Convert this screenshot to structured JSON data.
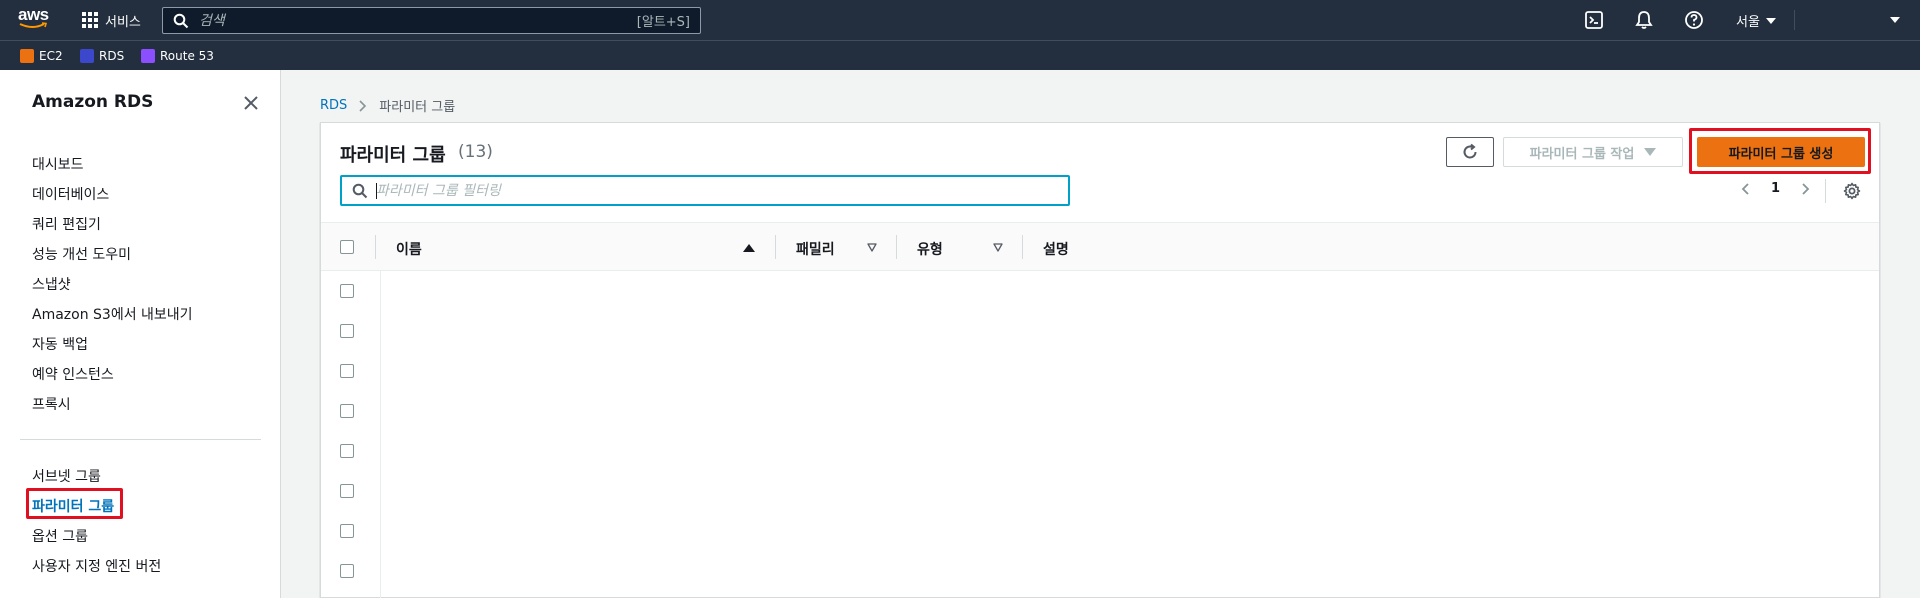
{
  "topnav": {
    "logo_text": "aws",
    "services_label": "서비스",
    "search_placeholder": "검색",
    "search_shortcut": "[알트+S]",
    "region_label": "서울"
  },
  "favorites": [
    {
      "label": "EC2",
      "color": "#ec7211"
    },
    {
      "label": "RDS",
      "color": "#3b48cc"
    },
    {
      "label": "Route 53",
      "color": "#8c4fff"
    }
  ],
  "sidebar": {
    "title": "Amazon RDS",
    "items": [
      {
        "label": "대시보드"
      },
      {
        "label": "데이터베이스"
      },
      {
        "label": "쿼리 편집기"
      },
      {
        "label": "성능 개선 도우미"
      },
      {
        "label": "스냅샷"
      },
      {
        "label": "Amazon S3에서 내보내기"
      },
      {
        "label": "자동 백업"
      },
      {
        "label": "예약 인스턴스"
      },
      {
        "label": "프록시"
      }
    ],
    "items2": [
      {
        "label": "서브넷 그룹"
      },
      {
        "label": "파라미터 그룹"
      },
      {
        "label": "옵션 그룹"
      },
      {
        "label": "사용자 지정 엔진 버전"
      }
    ]
  },
  "breadcrumb": {
    "root": "RDS",
    "current": "파라미터 그룹"
  },
  "panel": {
    "title": "파라미터 그룹",
    "count": "(13)",
    "actions_label": "파라미터 그룹 작업",
    "create_label": "파라미터 그룹 생성",
    "filter_placeholder": "파라미터 그룹 필터링",
    "page_number": "1"
  },
  "table": {
    "columns": [
      {
        "label": "이름"
      },
      {
        "label": "패밀리"
      },
      {
        "label": "유형"
      },
      {
        "label": "설명"
      }
    ]
  },
  "colors": {
    "nav_bg": "#232f3e",
    "accent_orange": "#ec7211",
    "link_blue": "#0073bb",
    "highlight_red": "#e01020"
  }
}
